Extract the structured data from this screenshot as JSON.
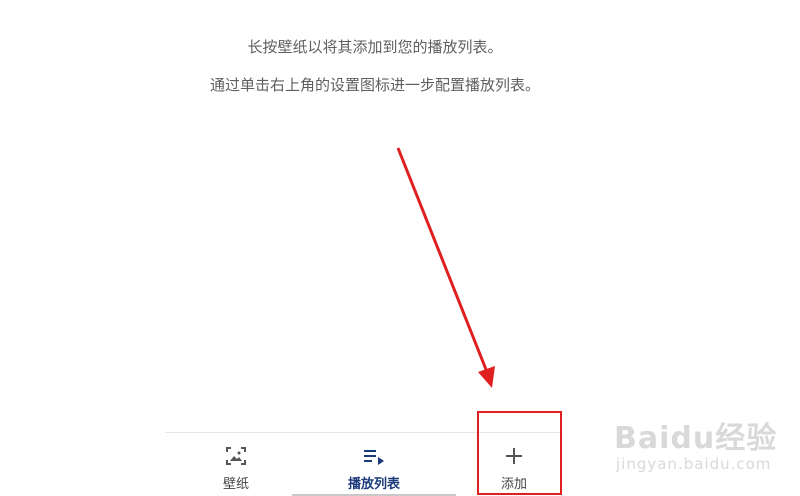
{
  "empty_state": {
    "hint_long_press": "长按壁纸以将其添加到您的播放列表。",
    "hint_settings": "通过单击右上角的设置图标进一步配置播放列表。"
  },
  "bottom_nav": {
    "items": [
      {
        "label": "壁纸",
        "icon": "wallpaper-icon"
      },
      {
        "label": "播放列表",
        "icon": "playlist-icon",
        "active": true
      },
      {
        "label": "添加",
        "icon": "plus-icon"
      }
    ],
    "active_color": "#1a3a7a"
  },
  "annotation": {
    "color": "#e02020"
  },
  "watermark": {
    "text": "Baidu经验",
    "subtext": "jingyan.baidu.com"
  }
}
